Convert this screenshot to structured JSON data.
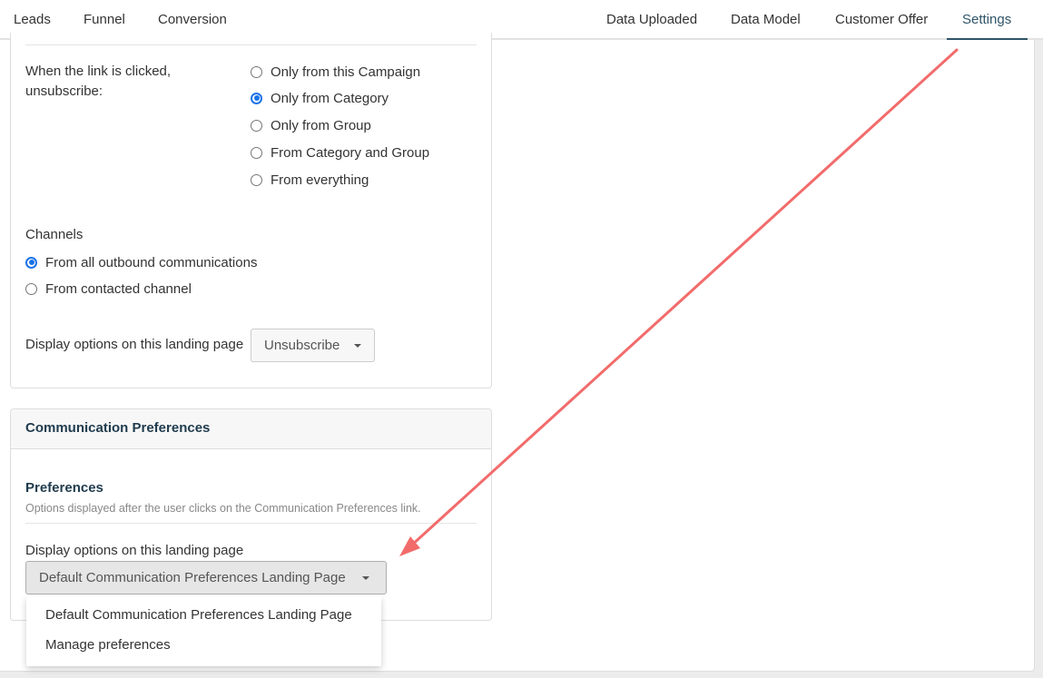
{
  "nav": {
    "left_tabs": [
      "Leads",
      "Funnel",
      "Conversion"
    ],
    "right_tabs": [
      "Data Uploaded",
      "Data Model",
      "Customer Offer",
      "Settings"
    ],
    "active_tab": "Settings",
    "accent_color": "#2f5468"
  },
  "unsubscribe": {
    "label": "When the link is clicked, unsubscribe:",
    "label_line1": "When the link is clicked,",
    "label_line2": "unsubscribe:",
    "options": [
      {
        "label": "Only from this Campaign",
        "checked": false
      },
      {
        "label": "Only from Category",
        "checked": true
      },
      {
        "label": "Only from Group",
        "checked": false
      },
      {
        "label": "From Category and Group",
        "checked": false
      },
      {
        "label": "From everything",
        "checked": false
      }
    ],
    "channels_label": "Channels",
    "channels": [
      {
        "label": "From all outbound communications",
        "checked": true
      },
      {
        "label": "From contacted channel",
        "checked": false
      }
    ],
    "display_label": "Display options on this landing page",
    "display_value": "Unsubscribe"
  },
  "communication_preferences": {
    "panel_title": "Communication Preferences",
    "section_title": "Preferences",
    "section_desc": "Options displayed after the user clicks on the Communication Preferences link.",
    "display_label": "Display options on this landing page",
    "display_value": "Default Communication Preferences Landing Page",
    "dropdown_options": [
      "Default Communication Preferences Landing Page",
      "Manage preferences"
    ]
  },
  "annotation": {
    "arrow_color": "#f26b6b"
  }
}
